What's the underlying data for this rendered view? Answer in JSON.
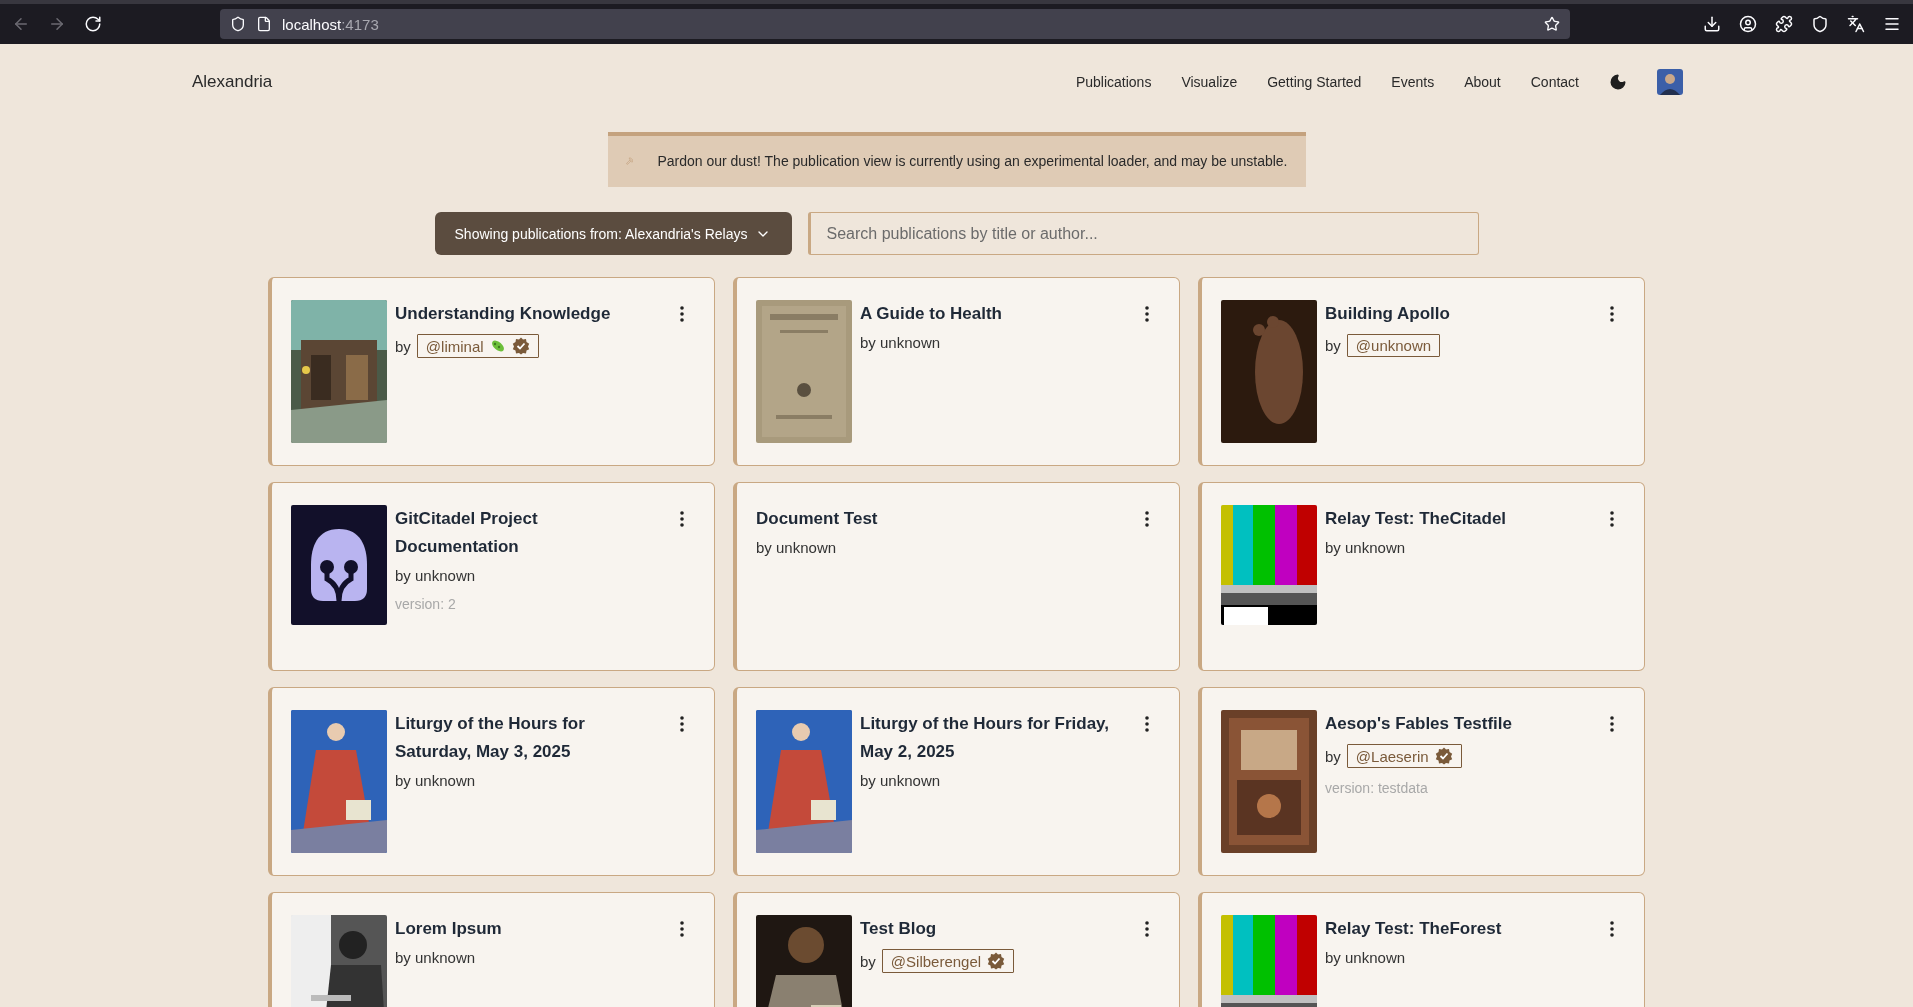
{
  "browser": {
    "url_host": "localhost",
    "url_port": ":4173"
  },
  "header": {
    "brand": "Alexandria",
    "nav": [
      "Publications",
      "Visualize",
      "Getting Started",
      "Events",
      "About",
      "Contact"
    ]
  },
  "banner": {
    "text": "Pardon our dust! The publication view is currently using an experimental loader, and may be unstable."
  },
  "filter": {
    "label": "Showing publications from: Alexandria's Relays",
    "placeholder": "Search publications by title or author..."
  },
  "cards": [
    {
      "title": "Understanding Knowledge",
      "by": "by",
      "author": "@liminal",
      "kind": "handle",
      "extra_badge": true,
      "verified": true
    },
    {
      "title": "A Guide to Health",
      "by": "by unknown",
      "kind": "plain"
    },
    {
      "title": "Building Apollo",
      "by": "by",
      "author": "@unknown",
      "kind": "handle",
      "extra_badge": false,
      "verified": false
    },
    {
      "title": "GitCitadel Project Documentation",
      "cover": {
        "kind": "logo"
      },
      "by": "by unknown",
      "kind": "plain",
      "version": "version: 2"
    },
    {
      "title": "Document Test",
      "by": "by unknown",
      "kind": "plain"
    },
    {
      "title": "Relay Test: TheCitadel",
      "by": "by unknown",
      "kind": "plain"
    },
    {
      "title": "Liturgy of the Hours for Saturday, May 3, 2025",
      "by": "by unknown",
      "kind": "plain"
    },
    {
      "title": "Liturgy of the Hours for Friday, May 2, 2025",
      "by": "by unknown",
      "kind": "plain"
    },
    {
      "title": "Aesop's Fables Testfile",
      "by": "by",
      "author": "@Laeserin",
      "kind": "handle",
      "extra_badge": false,
      "verified": true,
      "version": "version: testdata"
    },
    {
      "title": "Lorem Ipsum",
      "by": "by unknown",
      "kind": "plain"
    },
    {
      "title": "Test Blog",
      "by": "by",
      "author": "@Silberengel",
      "kind": "handle",
      "extra_badge": false,
      "verified": true
    },
    {
      "title": "Relay Test: TheForest",
      "by": "by unknown",
      "kind": "plain"
    }
  ]
}
